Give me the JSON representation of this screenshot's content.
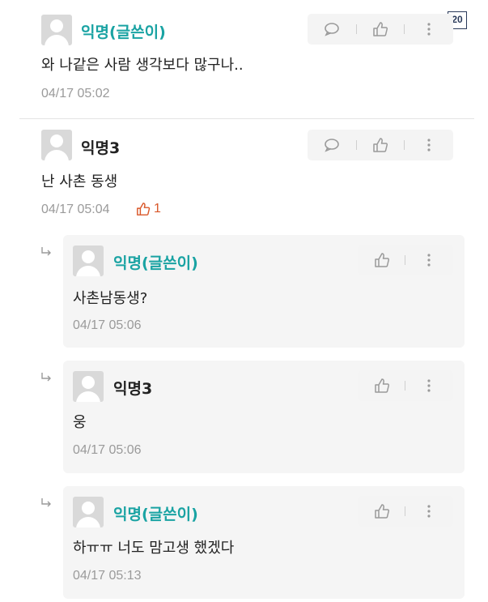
{
  "page_number": "20",
  "comments": [
    {
      "author": "익명(글쓴이)",
      "text": "와 나같은 사람 생각보다 많구나..",
      "date": "04/17 05:02"
    },
    {
      "author": "익명3",
      "text": "난 사촌 동생",
      "date": "04/17 05:04",
      "likes": "1"
    }
  ],
  "replies": [
    {
      "author": "익명(글쓴이)",
      "text": "사촌남동생?",
      "date": "04/17 05:06"
    },
    {
      "author": "익명3",
      "text": "웅",
      "date": "04/17 05:06"
    },
    {
      "author": "익명(글쓴이)",
      "text": "하ㅠㅠ 너도 맘고생 했겠다",
      "date": "04/17 05:13"
    }
  ],
  "icons": {
    "reply": "speech-bubble-icon",
    "like": "thumbs-up-icon",
    "more": "more-vertical-icon",
    "reply_arrow": "reply-arrow-icon"
  },
  "colors": {
    "op_author": "#1aa3a3",
    "like_count": "#d9582a",
    "meta_gray": "#9a9a9a",
    "action_bg": "#f4f4f4",
    "reply_bg": "#f5f5f5"
  }
}
